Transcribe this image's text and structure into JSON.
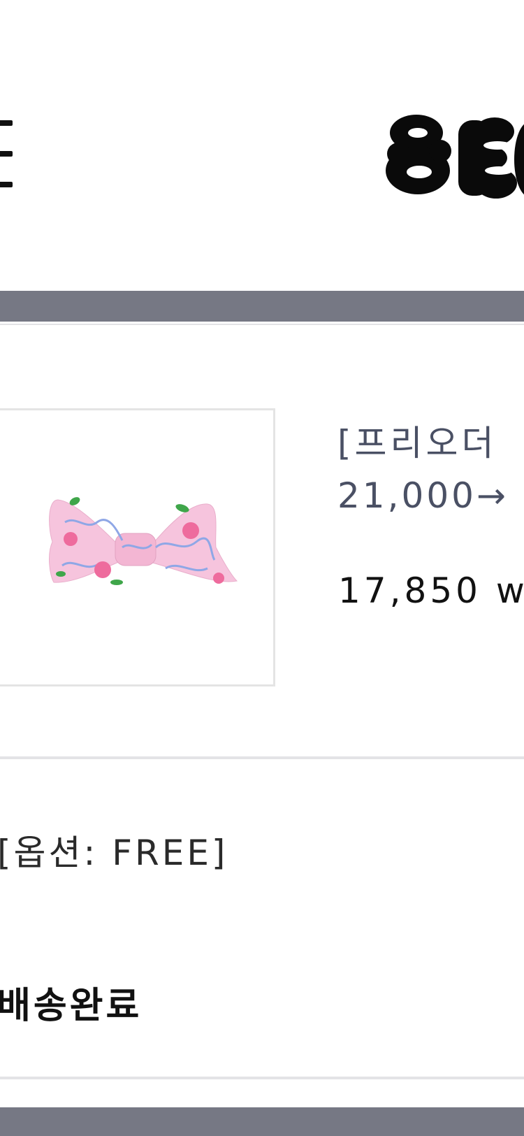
{
  "header": {
    "menu_icon": "hamburger-menu-icon",
    "logo_icon": "brand-logo-icon"
  },
  "product": {
    "image_icon": "pink-floral-bow-image",
    "title": "[프리오더",
    "original_price": "21,000→",
    "sale_price": "17,850 w"
  },
  "order": {
    "option": "[옵션: FREE]",
    "status": "배송완료"
  },
  "colors": {
    "bar": "#767884",
    "title_text": "#4a5064",
    "price_text": "#111111",
    "thumb_border": "#e4e4e4"
  }
}
